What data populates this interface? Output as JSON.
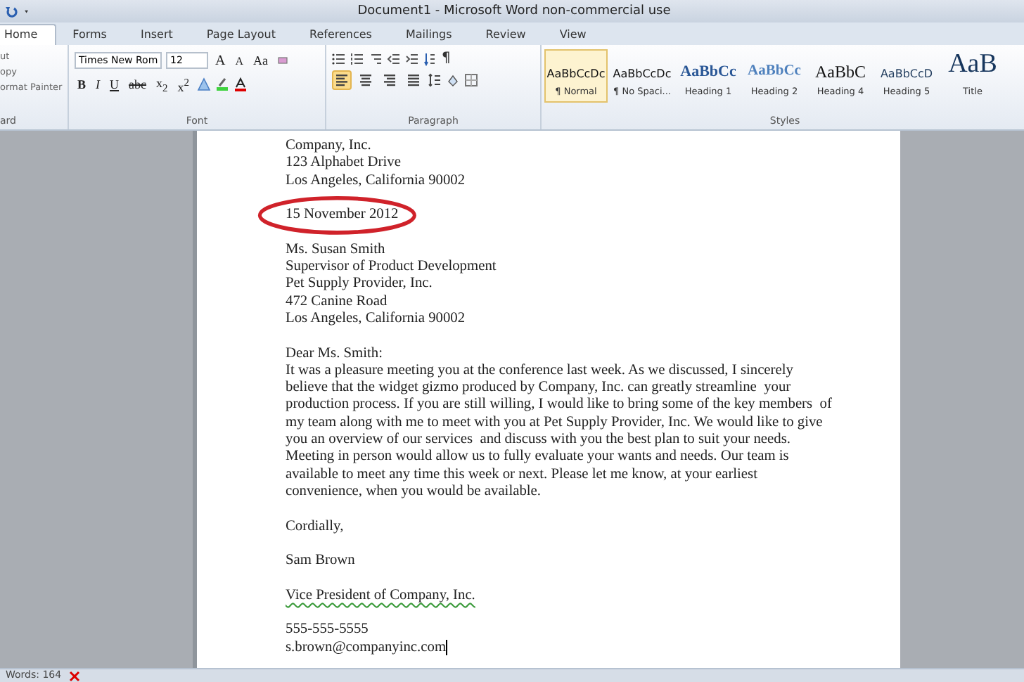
{
  "window": {
    "title": "Document1 - Microsoft Word non-commercial use"
  },
  "tabs": [
    {
      "label": "Home",
      "selected": true
    },
    {
      "label": "Forms",
      "selected": false
    },
    {
      "label": "Insert",
      "selected": false
    },
    {
      "label": "Page Layout",
      "selected": false
    },
    {
      "label": "References",
      "selected": false
    },
    {
      "label": "Mailings",
      "selected": false
    },
    {
      "label": "Review",
      "selected": false
    },
    {
      "label": "View",
      "selected": false
    }
  ],
  "clipboard": {
    "items": [
      "ut",
      "opy",
      "ormat Painter"
    ],
    "label": "ard"
  },
  "font": {
    "name": "Times New Rom",
    "size": "12",
    "grow_button": "A",
    "shrink_button": "A",
    "case_button": "Aa",
    "format_buttons": [
      "B",
      "I",
      "U",
      "abc",
      "x$_{2}$",
      "x$^{2}$"
    ],
    "label": "Font"
  },
  "paragraph": {
    "alignments": [
      {
        "kind": "left",
        "selected": true
      },
      {
        "kind": "center",
        "selected": false
      },
      {
        "kind": "right",
        "selected": false
      },
      {
        "kind": "justify",
        "selected": false
      }
    ],
    "pilcrow": "¶",
    "label": "Paragraph"
  },
  "styles": {
    "items": [
      {
        "preview": "AaBbCcDc",
        "name": "¶ Normal",
        "kind": "normal",
        "selected": true
      },
      {
        "preview": "AaBbCcDc",
        "name": "¶ No Spaci...",
        "kind": "normal",
        "selected": false
      },
      {
        "preview": "AaBbCc",
        "name": "Heading 1",
        "kind": "heading1",
        "selected": false
      },
      {
        "preview": "AaBbCc",
        "name": "Heading 2",
        "kind": "heading2",
        "selected": false
      },
      {
        "preview": "AaBbC",
        "name": "Heading 4",
        "kind": "heading4",
        "selected": false
      },
      {
        "preview": "AaBbCcD",
        "name": "Heading 5",
        "kind": "heading5",
        "selected": false
      },
      {
        "preview": "AaB",
        "name": "Title",
        "kind": "title",
        "selected": false
      }
    ],
    "label": "Styles"
  },
  "document": {
    "blocks": [
      {
        "lines": [
          "Company, Inc.",
          "123 Alphabet Drive",
          "Los Angeles, California 90002"
        ]
      },
      {
        "lines": [
          "15 November 2012"
        ],
        "circled": true
      },
      {
        "lines": [
          "Ms. Susan Smith",
          "Supervisor of Product Development",
          "Pet Supply Provider, Inc.",
          "472 Canine Road",
          "Los Angeles, California 90002"
        ]
      },
      {
        "lines": [
          "Dear Ms. Smith:",
          "It was a pleasure meeting you at the conference last week. As we discussed, I sincerely",
          "believe that the widget gizmo produced by Company, Inc. can greatly streamline  your",
          "production process. If you are still willing, I would like to bring some of the key members  of",
          "my team along with me to meet with you at Pet Supply Provider, Inc. We would like to give",
          "you an overview of our services  and discuss with you the best plan to suit your needs.",
          "Meeting in person would allow us to fully evaluate your wants and needs. Our team is",
          "available to meet any time this week or next. Please let me know, at your earliest",
          "convenience, when you would be available."
        ]
      },
      {
        "lines": [
          "Cordially,"
        ]
      },
      {
        "lines": [
          "Sam Brown"
        ]
      },
      {
        "lines": [
          "Vice President of Company, Inc."
        ],
        "kind": "underlined"
      },
      {
        "lines": [
          "555-555-5555",
          "s.brown@companyinc.com"
        ]
      }
    ]
  },
  "status_bar": {
    "words": "Words: 164"
  }
}
